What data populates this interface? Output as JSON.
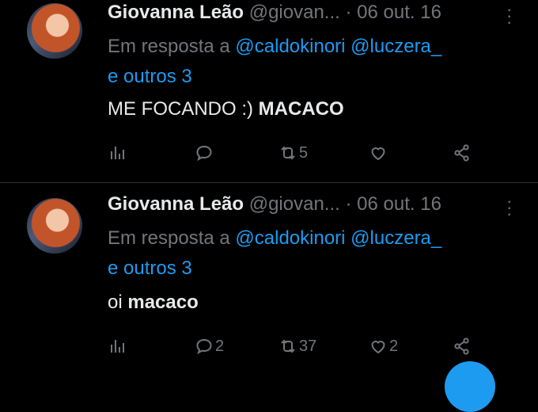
{
  "tweets": [
    {
      "name": "Giovanna Leão",
      "handle": "@giovan...",
      "dot": "·",
      "date": "06 out. 16",
      "reply_prefix": "Em resposta a",
      "mention1": "@caldokinori",
      "mention2": "@luczera_",
      "reply_more": "e outros 3",
      "text_main": "ME FOCANDO :) ",
      "text_highlight": "MACACO",
      "counts": {
        "reply": "",
        "retweet": "5",
        "like": ""
      }
    },
    {
      "name": "Giovanna Leão",
      "handle": "@giovan...",
      "dot": "·",
      "date": "06 out. 16",
      "reply_prefix": "Em resposta a",
      "mention1": "@caldokinori",
      "mention2": "@luczera_",
      "reply_more": "e outros 3",
      "text_main": "oi ",
      "text_highlight": "macaco",
      "counts": {
        "reply": "2",
        "retweet": "37",
        "like": "2"
      }
    }
  ],
  "icons": {
    "views": "bar-chart-icon",
    "reply": "reply-icon",
    "retweet": "retweet-icon",
    "like": "heart-icon",
    "share": "share-icon",
    "more": "more-vertical-icon"
  },
  "colors": {
    "background": "#000000",
    "text": "#e7e9ea",
    "muted": "#71767b",
    "link": "#1d9bf0",
    "divider": "#2f3336"
  }
}
